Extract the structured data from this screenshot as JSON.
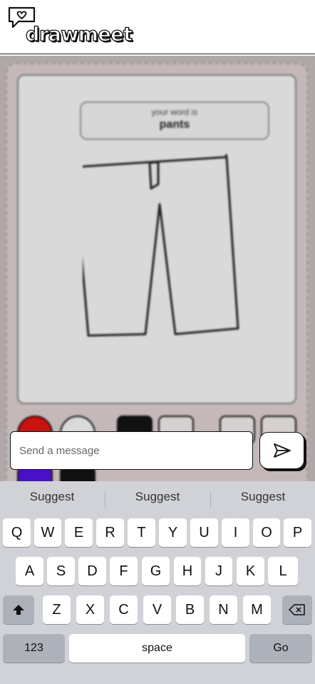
{
  "header": {
    "app_name": "drawmeet"
  },
  "game": {
    "word_caption": "your word is",
    "word": "pants"
  },
  "message": {
    "placeholder": "Send a message"
  },
  "keyboard": {
    "suggestions": [
      "Suggest",
      "Suggest",
      "Suggest"
    ],
    "row1": [
      "Q",
      "W",
      "E",
      "R",
      "T",
      "Y",
      "U",
      "I",
      "O",
      "P"
    ],
    "row2": [
      "A",
      "S",
      "D",
      "F",
      "G",
      "H",
      "J",
      "K",
      "L"
    ],
    "row3": [
      "Z",
      "X",
      "C",
      "V",
      "B",
      "N",
      "M"
    ],
    "numbers_key": "123",
    "space_key": "space",
    "go_key": "Go"
  },
  "colors": {
    "red": "#cc1111",
    "purple": "#4a10c8",
    "black": "#111111",
    "board": "#c4b8b8"
  }
}
